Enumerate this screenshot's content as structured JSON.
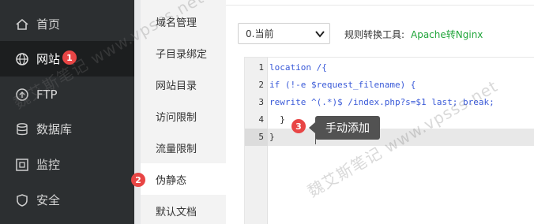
{
  "sidebar": {
    "items": [
      {
        "label": "首页",
        "icon": "home-icon"
      },
      {
        "label": "网站",
        "icon": "globe-icon",
        "active": true
      },
      {
        "label": "FTP",
        "icon": "ftp-icon"
      },
      {
        "label": "数据库",
        "icon": "database-icon"
      },
      {
        "label": "监控",
        "icon": "monitor-icon"
      },
      {
        "label": "安全",
        "icon": "shield-icon"
      }
    ]
  },
  "submenu": {
    "items": [
      {
        "label": "域名管理"
      },
      {
        "label": "子目录绑定"
      },
      {
        "label": "网站目录"
      },
      {
        "label": "访问限制"
      },
      {
        "label": "流量限制"
      },
      {
        "label": "伪静态",
        "active": true
      },
      {
        "label": "默认文档"
      }
    ]
  },
  "toolbar": {
    "select_value": "0.当前",
    "rule_label": "规则转换工具:",
    "rule_link": "Apache转Nginx"
  },
  "editor": {
    "line_numbers": [
      "1",
      "2",
      "3",
      "4",
      "5"
    ],
    "lines": [
      "location /{",
      "if (!-e $request_filename) {",
      "rewrite ^(.*)$ /index.php?s=$1 last; break;",
      "  }",
      "}"
    ]
  },
  "annotations": {
    "badge1": "1",
    "badge2": "2",
    "badge3": "3",
    "tooltip": "手动添加"
  },
  "watermark": {
    "text1": "魏艾斯笔记 www.vpsss.net",
    "text2": "魏艾斯笔记 www.vpsss.net"
  },
  "colors": {
    "sidebar_bg": "#2c2f31",
    "link_green": "#20a53a",
    "badge_red": "#e84545",
    "tooltip_bg": "#525252"
  }
}
